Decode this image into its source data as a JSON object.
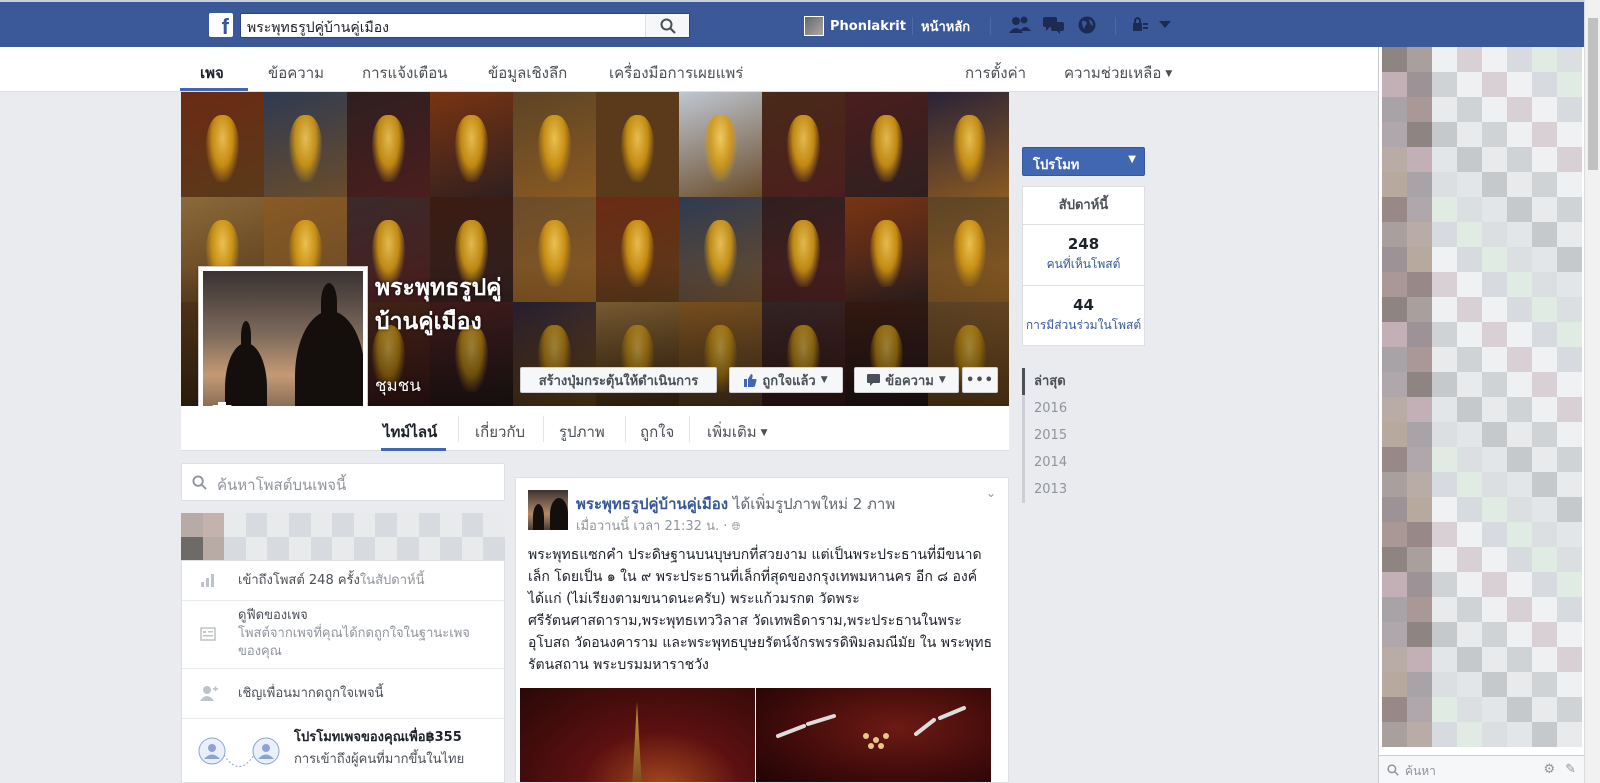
{
  "topbar": {
    "search_value": "พระพุทธรูปคู่บ้านคู่เมือง",
    "user_name": "Phonlakrit",
    "home_label": "หน้าหลัก"
  },
  "page_nav": {
    "items": [
      "เพจ",
      "ข้อความ",
      "การแจ้งเตือน",
      "ข้อมูลเชิงลึก",
      "เครื่องมือการเผยแพร่"
    ],
    "settings": "การตั้งค่า",
    "help": "ความช่วยเหลือ"
  },
  "cover": {
    "page_name": "พระพุทธรูปคู่บ้านคู่เมือง",
    "category": "ชุมชน",
    "cta_button": "สร้างปุ่มกระตุ้นให้ดำเนินการ",
    "liked_button": "ถูกใจแล้ว",
    "message_button": "ข้อความ",
    "more_button": "•••"
  },
  "tabs": [
    "ไทม์ไลน์",
    "เกี่ยวกับ",
    "รูปภาพ",
    "ถูกใจ",
    "เพิ่มเติม"
  ],
  "left": {
    "search_placeholder": "ค้นหาโพสต์บนเพจนี้",
    "reach_text": "เข้าถึงโพสต์ 248 ครั้ง",
    "reach_suffix": "ในสัปดาห์นี้",
    "feed_title": "ดูฟีดของเพจ",
    "feed_desc": "โพสต์จากเพจที่คุณได้กดถูกใจในฐานะเพจของคุณ",
    "invite": "เชิญเพื่อนมากดถูกใจเพจนี้",
    "promo_title": "โปรโมทเพจของคุณเพื่อ฿355",
    "promo_desc": "การเข้าถึงผู้คนที่มากขึ้นในไทย"
  },
  "post": {
    "author": "พระพุทธรูปคู่บ้านคู่เมือง",
    "action": "ได้เพิ่มรูปภาพใหม่ 2 ภาพ",
    "time": "เมื่อวานนี้ เวลา 21:32 น. ·",
    "body": "พระพุทธแซกคำ ประดิษฐานบนบุษบกที่สวยงาม แต่เป็นพระประธานที่มีขนาดเล็ก โดยเป็น ๑ ใน ๙ พระประธานที่เล็กที่สุดของกรุงเทพมหานคร อีก ๘ องค์ได้แก่ (ไม่เรียงตามขนาดนะครับ) พระแก้วมรกต วัดพระศรีรัตนศาสดาราม,พระพุทธเทววิลาส วัดเทพธิดาราม,พระประธานในพระอุโบสถ วัดอนงคาราม และพระพุทธบุษยรัตน์จักรพรรดิพิมลมณีมัย ใน พระพุทธรัตนสถาน พระบรมมหาราชวัง"
  },
  "right": {
    "promote": "โปรโมท",
    "week_title": "สัปดาห์นี้",
    "stats": [
      {
        "value": "248",
        "label": "คนที่เห็นโพสต์"
      },
      {
        "value": "44",
        "label": "การมีส่วนร่วมในโพสต์"
      }
    ],
    "years": [
      "ล่าสุด",
      "2016",
      "2015",
      "2014",
      "2013"
    ]
  },
  "chat": {
    "search_placeholder": "ค้นหา"
  },
  "colors": {
    "brand": "#3b5998",
    "link": "#365899",
    "background": "#e9ebee"
  }
}
